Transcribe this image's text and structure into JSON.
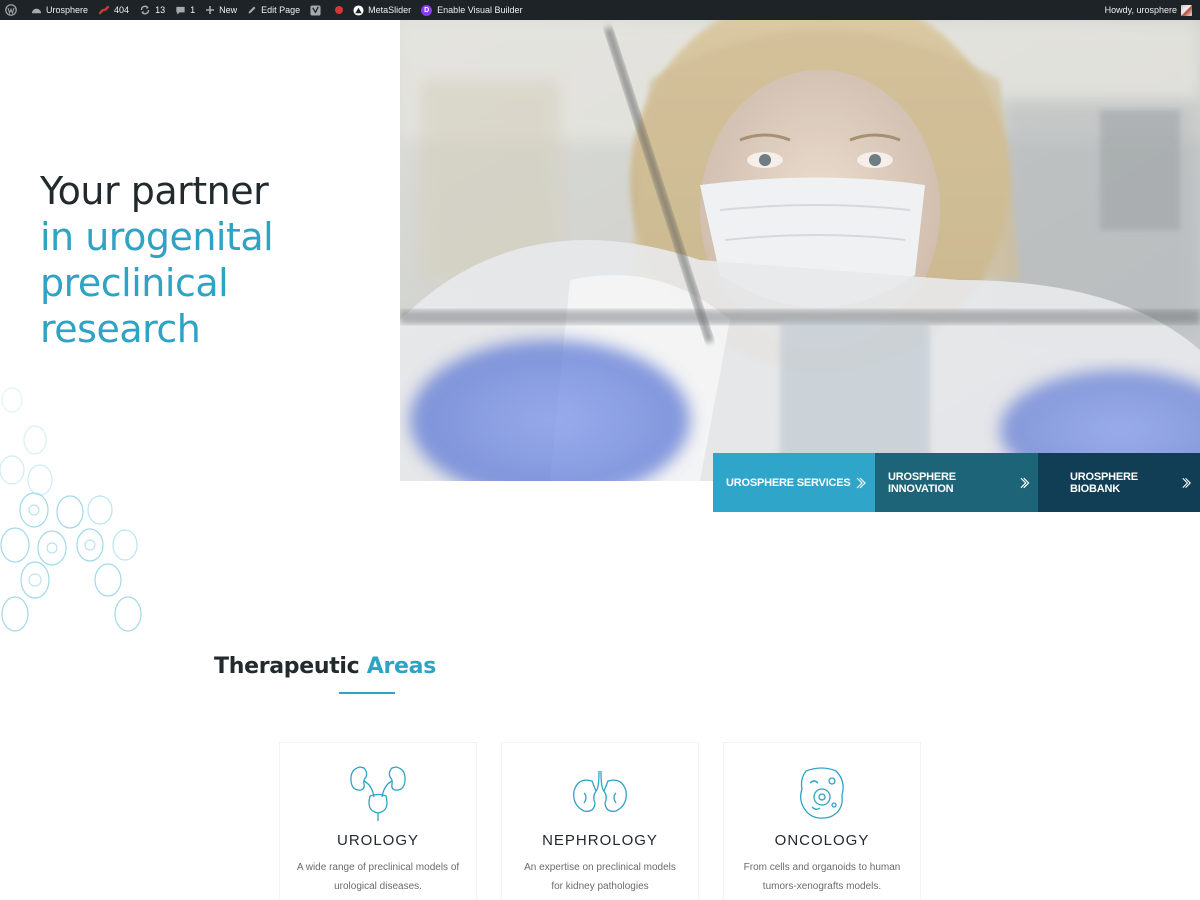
{
  "adminbar": {
    "site_name": "Urosphere",
    "broken_links": "404",
    "updates": "13",
    "comments": "1",
    "new": "New",
    "edit_page": "Edit Page",
    "metaslider": "MetaSlider",
    "visual_builder": "Enable Visual Builder",
    "howdy": "Howdy, urosphere"
  },
  "hero": {
    "line1": "Your partner",
    "line2": "in urogenital",
    "line3": "preclinical research",
    "buttons": [
      {
        "label": "UROSPHERE SERVICES",
        "color": "#2fa6c9"
      },
      {
        "label": "UROSPHERE INNOVATION",
        "color": "#1d6478"
      },
      {
        "label": "UROSPHERE BIOBANK",
        "color": "#123e55"
      }
    ]
  },
  "therapeutic": {
    "title_dark": "Therapeutic",
    "title_accent": "Areas",
    "cards": [
      {
        "icon": "urology-icon",
        "title": "UROLOGY",
        "desc_line1": "A wide range of preclinical models of",
        "desc_line2": "urological diseases."
      },
      {
        "icon": "kidneys-icon",
        "title": "NEPHROLOGY",
        "desc_line1": "An expertise on preclinical models",
        "desc_line2": "for kidney pathologies"
      },
      {
        "icon": "cell-icon",
        "title": "ONCOLOGY",
        "desc_line1": "From cells and organoids to human",
        "desc_line2": "tumors-xenografts models."
      }
    ]
  },
  "colors": {
    "accent": "#2ea3c4",
    "dark_text": "#222a2e",
    "adminbar_bg": "#1d2327"
  }
}
